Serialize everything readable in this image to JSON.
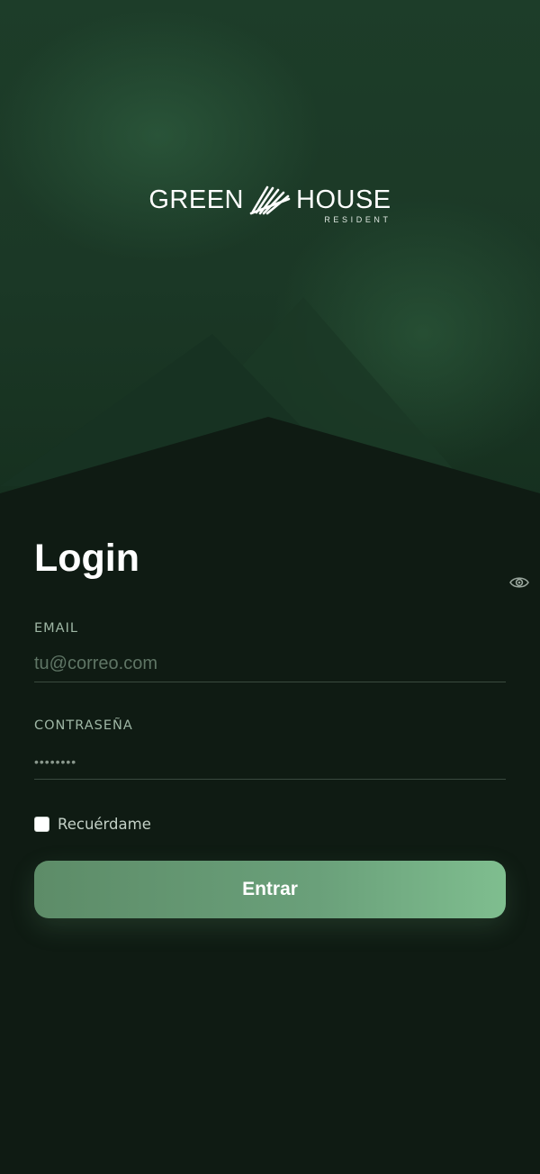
{
  "brand": {
    "word_left": "GREEN",
    "word_right": "HOUSE",
    "subtitle": "RESIDENT",
    "icon": "palm-leaf-icon"
  },
  "login": {
    "title": "Login",
    "email": {
      "label": "EMAIL",
      "value": "",
      "placeholder": "tu@correo.com"
    },
    "password": {
      "label": "CONTRASEÑA",
      "value": "",
      "placeholder": "••••••••",
      "toggle_icon": "eye-icon"
    },
    "remember": {
      "label": "Recuérdame",
      "checked": false
    },
    "submit_label": "Entrar"
  },
  "colors": {
    "background": "#0f1b13",
    "hero": "#1d3d29",
    "accent": "#6aa07a",
    "label": "#9fb7a5"
  }
}
